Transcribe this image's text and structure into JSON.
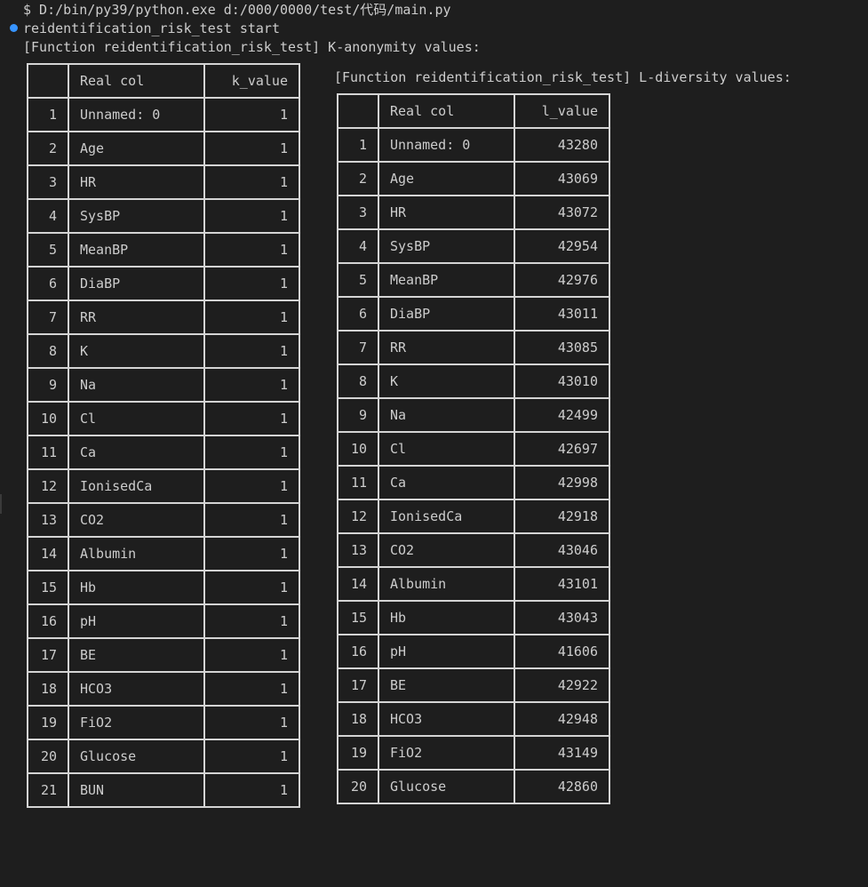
{
  "terminal": {
    "command_line": "$ D:/bin/py39/python.exe d:/000/0000/test/代码/main.py",
    "start_line": "reidentification_risk_test start",
    "k_header": "[Function reidentification_risk_test] K-anonymity values:",
    "l_header": "[Function reidentification_risk_test] L-diversity values:",
    "status_dot_color": "#3794ff"
  },
  "k_table": {
    "columns": [
      "",
      "Real col",
      "k_value"
    ],
    "rows": [
      {
        "idx": "1",
        "col": "Unnamed: 0",
        "val": "1"
      },
      {
        "idx": "2",
        "col": "Age",
        "val": "1"
      },
      {
        "idx": "3",
        "col": "HR",
        "val": "1"
      },
      {
        "idx": "4",
        "col": "SysBP",
        "val": "1"
      },
      {
        "idx": "5",
        "col": "MeanBP",
        "val": "1"
      },
      {
        "idx": "6",
        "col": "DiaBP",
        "val": "1"
      },
      {
        "idx": "7",
        "col": "RR",
        "val": "1"
      },
      {
        "idx": "8",
        "col": "K",
        "val": "1"
      },
      {
        "idx": "9",
        "col": "Na",
        "val": "1"
      },
      {
        "idx": "10",
        "col": "Cl",
        "val": "1"
      },
      {
        "idx": "11",
        "col": "Ca",
        "val": "1"
      },
      {
        "idx": "12",
        "col": "IonisedCa",
        "val": "1"
      },
      {
        "idx": "13",
        "col": "CO2",
        "val": "1"
      },
      {
        "idx": "14",
        "col": "Albumin",
        "val": "1"
      },
      {
        "idx": "15",
        "col": "Hb",
        "val": "1"
      },
      {
        "idx": "16",
        "col": "pH",
        "val": "1"
      },
      {
        "idx": "17",
        "col": "BE",
        "val": "1"
      },
      {
        "idx": "18",
        "col": "HCO3",
        "val": "1"
      },
      {
        "idx": "19",
        "col": "FiO2",
        "val": "1"
      },
      {
        "idx": "20",
        "col": "Glucose",
        "val": "1"
      },
      {
        "idx": "21",
        "col": "BUN",
        "val": "1"
      }
    ]
  },
  "l_table": {
    "columns": [
      "",
      "Real col",
      "l_value"
    ],
    "rows": [
      {
        "idx": "1",
        "col": "Unnamed: 0",
        "val": "43280"
      },
      {
        "idx": "2",
        "col": "Age",
        "val": "43069"
      },
      {
        "idx": "3",
        "col": "HR",
        "val": "43072"
      },
      {
        "idx": "4",
        "col": "SysBP",
        "val": "42954"
      },
      {
        "idx": "5",
        "col": "MeanBP",
        "val": "42976"
      },
      {
        "idx": "6",
        "col": "DiaBP",
        "val": "43011"
      },
      {
        "idx": "7",
        "col": "RR",
        "val": "43085"
      },
      {
        "idx": "8",
        "col": "K",
        "val": "43010"
      },
      {
        "idx": "9",
        "col": "Na",
        "val": "42499"
      },
      {
        "idx": "10",
        "col": "Cl",
        "val": "42697"
      },
      {
        "idx": "11",
        "col": "Ca",
        "val": "42998"
      },
      {
        "idx": "12",
        "col": "IonisedCa",
        "val": "42918"
      },
      {
        "idx": "13",
        "col": "CO2",
        "val": "43046"
      },
      {
        "idx": "14",
        "col": "Albumin",
        "val": "43101"
      },
      {
        "idx": "15",
        "col": "Hb",
        "val": "43043"
      },
      {
        "idx": "16",
        "col": "pH",
        "val": "41606"
      },
      {
        "idx": "17",
        "col": "BE",
        "val": "42922"
      },
      {
        "idx": "18",
        "col": "HCO3",
        "val": "42948"
      },
      {
        "idx": "19",
        "col": "FiO2",
        "val": "43149"
      },
      {
        "idx": "20",
        "col": "Glucose",
        "val": "42860"
      }
    ]
  }
}
